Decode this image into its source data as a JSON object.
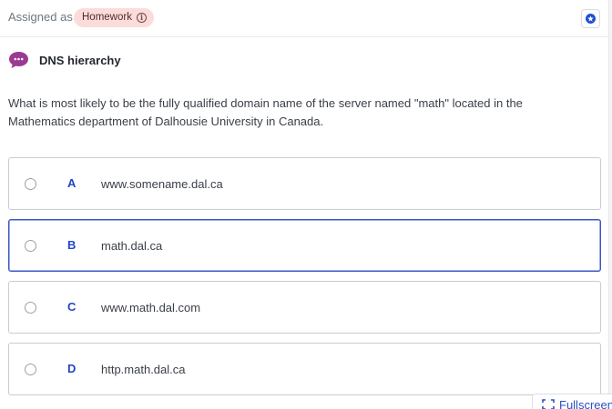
{
  "header": {
    "assigned_label": "Assigned as",
    "badge_label": "Homework",
    "colors": {
      "badge_bg": "#fcdcda",
      "accent": "#2045c8"
    }
  },
  "question": {
    "title": "DNS hierarchy",
    "text": "What is most likely to be the fully qualified domain name of the server named \"math\" located in the Mathematics department of Dalhousie University in Canada.",
    "icon": "chat-bubble-icon"
  },
  "options": [
    {
      "letter": "A",
      "text": "www.somename.dal.ca",
      "highlighted": false
    },
    {
      "letter": "B",
      "text": "math.dal.ca",
      "highlighted": true
    },
    {
      "letter": "C",
      "text": "www.math.dal.com",
      "highlighted": false
    },
    {
      "letter": "D",
      "text": "http.math.dal.ca",
      "highlighted": false
    }
  ],
  "footer": {
    "fullscreen_label": "Fullscreen",
    "fullscreen_icon": "expand-corners-icon"
  }
}
